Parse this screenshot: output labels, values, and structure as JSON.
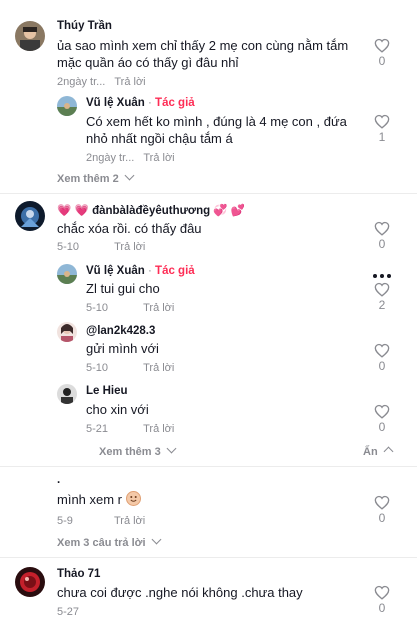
{
  "comments": [
    {
      "user": "Thúy Trần",
      "text_line1": "ủa sao mình xem chỉ thấy 2 mẹ con cùng nằm tắm",
      "text_line2": "mặc quần áo có thấy gì đâu nhỉ",
      "time": "2ngày tr...",
      "reply": "Trả lời",
      "likes": "0",
      "replies": [
        {
          "user": "Vũ lệ Xuân",
          "author_badge": "Tác giả",
          "dot": "·",
          "text_line1": "Có xem hết ko mình , đúng là 4 mẹ con , đứa",
          "text_line2": "nhỏ nhất ngồi chậu tắm á",
          "time": "2ngày tr...",
          "reply": "Trả lời",
          "likes": "1"
        }
      ],
      "see_more": "Xem thêm 2"
    },
    {
      "user": "đànbàlàđềyêuthương",
      "text": "chắc xóa rồi. có thấy đâu",
      "time": "5-10",
      "reply": "Trả lời",
      "likes": "0",
      "replies": [
        {
          "user": "Vũ lệ Xuân",
          "author_badge": "Tác giả",
          "dot": "·",
          "text": "Zl tui gui cho",
          "time": "5-10",
          "reply": "Trả lời",
          "likes": "2"
        },
        {
          "user": "@lan2k428.3",
          "text": "gửi mình với",
          "time": "5-10",
          "reply": "Trả lời",
          "likes": "0"
        },
        {
          "user": "Le Hieu",
          "text": "cho xin với",
          "time": "5-21",
          "reply": "Trả lời",
          "likes": "0"
        }
      ],
      "see_more": "Xem thêm 3",
      "hide": "Ẩn"
    },
    {
      "user": ".",
      "text": "mình xem r",
      "time": "5-9",
      "reply": "Trả lời",
      "likes": "0",
      "see_more": "Xem 3 câu trả lời"
    },
    {
      "user": "Thảo 71",
      "text": "chưa coi được .nghe nói không .chưa thay",
      "time": "5-27",
      "likes": "0"
    }
  ],
  "colors": {
    "author": "#fe2c55",
    "muted": "#8a8b91",
    "text": "#161823"
  },
  "icons": [
    "heart-icon",
    "more-options-icon",
    "chevron-down-icon",
    "heart-emoji-icon",
    "smile-sticker-icon"
  ]
}
